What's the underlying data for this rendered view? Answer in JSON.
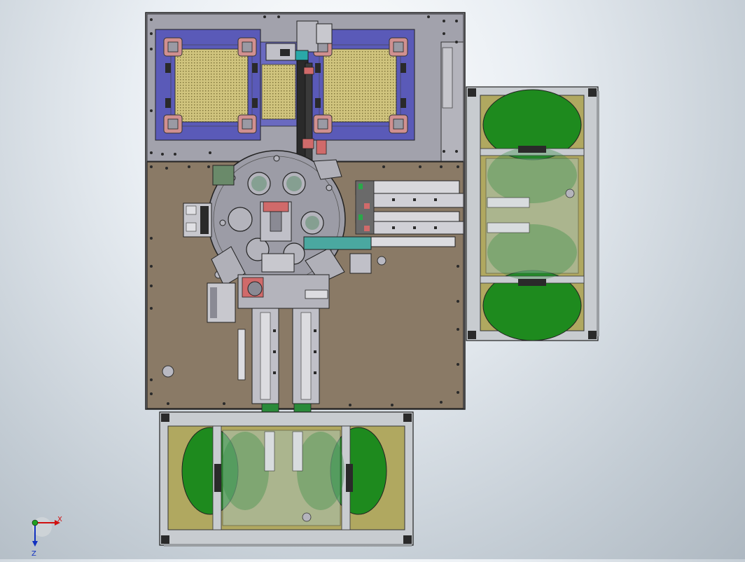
{
  "scene": {
    "view": "top",
    "colors": {
      "frame_plate": "#9a9aa4",
      "base_plate": "#8a7a66",
      "blue_fixture": "#5a5ab8",
      "tray_yellow": "#d8cc84",
      "green_bin": "#1e8a1e",
      "olive_panel": "#b0a860",
      "rail_dark": "#2a2a2a",
      "accent_red": "#d06a6a",
      "accent_teal": "#2aa8a8",
      "aluminum": "#c8ccd0"
    }
  },
  "triad": {
    "x_label": "X",
    "z_label": "Z"
  }
}
